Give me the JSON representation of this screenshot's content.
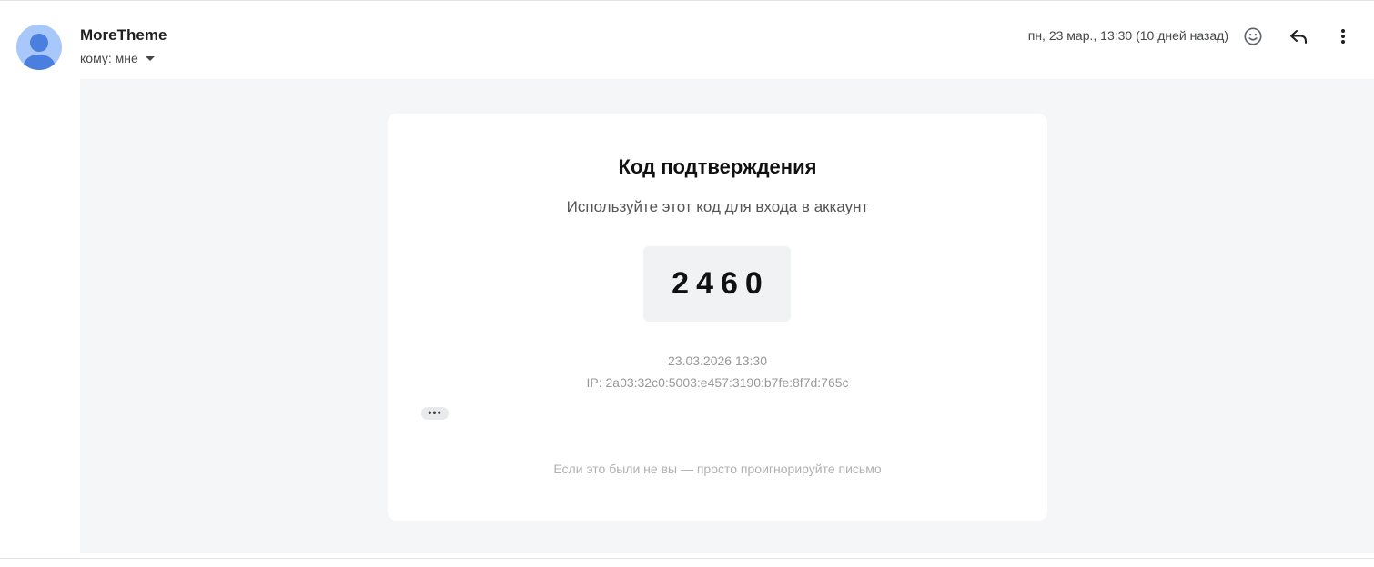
{
  "header": {
    "sender_name": "MoreTheme",
    "recipient_label": "кому: мне",
    "date": "пн, 23 мар., 13:30 (10 дней назад)",
    "icons": [
      "avatar-icon",
      "emoji-icon",
      "reply-icon",
      "more-vert-icon"
    ]
  },
  "message": {
    "title": "Код подтверждения",
    "subtitle": "Используйте этот код для входа в аккаунт",
    "code": "2460",
    "timestamp": "23.03.2026 13:30",
    "ip": "IP: 2a03:32c0:5003:e457:3190:b7fe:8f7d:765c",
    "trimmed_label": "•••",
    "footer": "Если это были не вы — просто проигнорируйте письмо"
  },
  "colors": {
    "avatar_bg": "#a8c7fa",
    "avatar_fg": "#4a7fe0",
    "body_bg": "#f5f6f7",
    "card_bg": "#ffffff",
    "code_bg": "#f1f2f4"
  }
}
